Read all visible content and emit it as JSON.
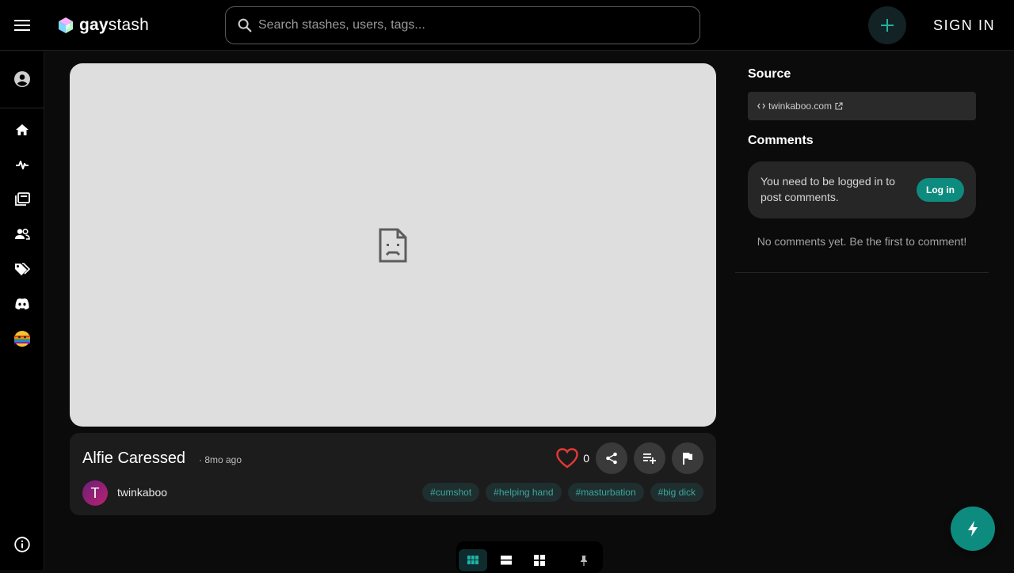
{
  "header": {
    "logo_bold": "gay",
    "logo_regular": "stash",
    "search_placeholder": "Search stashes, users, tags...",
    "sign_in_label": "SIGN IN"
  },
  "sidebar": {
    "items": [
      "account-icon",
      "home-icon",
      "activity-icon",
      "stashes-icon",
      "users-icon",
      "tags-icon",
      "discord-icon",
      "pride-emoji-icon",
      "info-icon"
    ]
  },
  "post": {
    "title": "Alfie Caressed",
    "age": "· 8mo ago",
    "like_count": "0",
    "author_initial": "T",
    "author": "twinkaboo",
    "tags": [
      "#cumshot",
      "#helping hand",
      "#masturbation",
      "#big dick"
    ]
  },
  "source": {
    "heading": "Source",
    "domain": "twinkaboo.com"
  },
  "comments": {
    "heading": "Comments",
    "login_prompt": "You need to be logged in to post comments.",
    "login_button": "Log in",
    "empty_text": "No comments yet. Be the first to comment!"
  },
  "colors": {
    "accent": "#0e8b7f",
    "tag_text": "#3ea79b",
    "like_heart": "#e53935"
  }
}
